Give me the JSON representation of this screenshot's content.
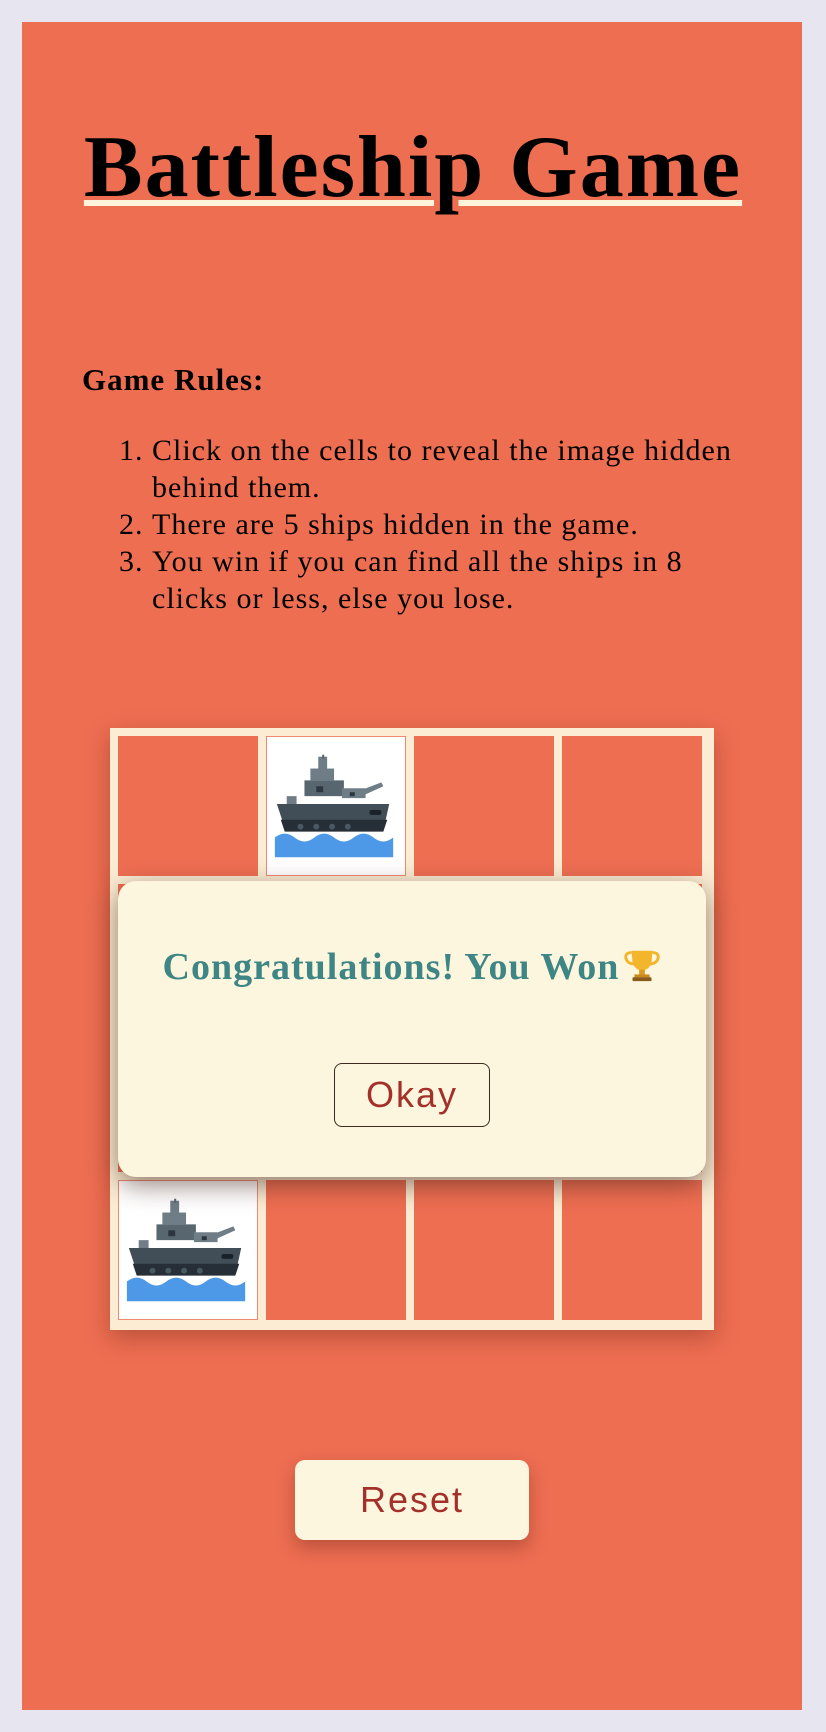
{
  "title": "Battleship Game",
  "rules": {
    "heading": "Game Rules:",
    "items": [
      "Click on the cells to reveal the image hidden behind them.",
      "There are 5 ships hidden in the game.",
      "You win if you can find all the ships in 8 clicks or less, else you lose."
    ]
  },
  "board": {
    "rows": 4,
    "cols": 4,
    "visible_revealed_cells": [
      {
        "row": 0,
        "col": 1,
        "content": "battleship-icon"
      },
      {
        "row": 3,
        "col": 0,
        "content": "battleship-icon"
      }
    ]
  },
  "modal": {
    "message": "Congratulations! You Won",
    "icon": "trophy-icon",
    "okay_label": "Okay"
  },
  "reset_label": "Reset",
  "colors": {
    "page_background": "#e7e5ef",
    "panel": "#ee6e52",
    "board_frame": "#fbecd3",
    "modal_background": "#fdf6df",
    "message_text": "#3e8585",
    "button_text": "#a4302a"
  }
}
